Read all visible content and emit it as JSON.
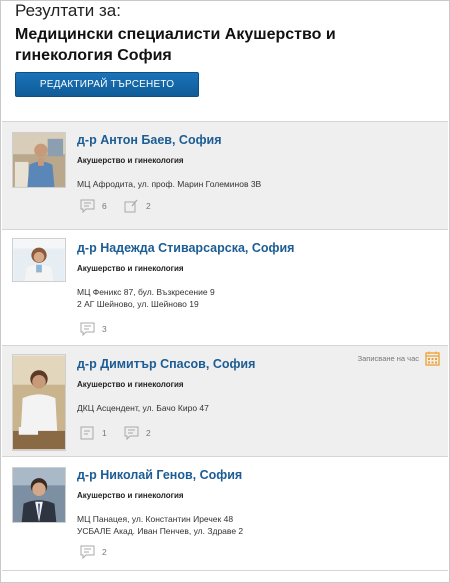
{
  "header": {
    "results_label": "Резултати за:",
    "query_line1": "Медицински специалисти Акушерство и",
    "query_line2": "гинекология София",
    "edit_button": "РЕДАКТИРАЙ ТЪРСЕНЕТО"
  },
  "doctors": [
    {
      "name": "д-р Антон Баев, София",
      "specialty": "Акушерство и гинекология",
      "address_lines": [
        "МЦ Афродита, ул. проф. Марин Големинов 3В"
      ],
      "comments": "6",
      "reviews": "2",
      "booking_label": ""
    },
    {
      "name": "д-р Надежда Стиварсарска, София",
      "specialty": "Акушерство и гинекология",
      "address_lines": [
        "МЦ Феникс 87, бул. Възкресение 9",
        "2 АГ Шейново, ул. Шейново 19"
      ],
      "comments": "3",
      "reviews": "",
      "booking_label": ""
    },
    {
      "name": "д-р Димитър Спасов, София",
      "specialty": "Акушерство и гинекология",
      "address_lines": [
        "ДКЦ Асцендент, ул. Бачо Киро 47"
      ],
      "comments": "1",
      "reviews": "2",
      "booking_label": "Записване на час"
    },
    {
      "name": "д-р Николай Генов, София",
      "specialty": "Акушерство и гинекология",
      "address_lines": [
        "МЦ Панацея, ул. Константин Иречек 48",
        "УСБАЛЕ Акад. Иван Пенчев, ул. Здраве 2"
      ],
      "comments": "2",
      "reviews": "",
      "booking_label": ""
    }
  ],
  "colors": {
    "link": "#1b5d94",
    "button": "#1368ab",
    "card_gray": "#efefef",
    "calendar_icon": "#f0a030"
  }
}
